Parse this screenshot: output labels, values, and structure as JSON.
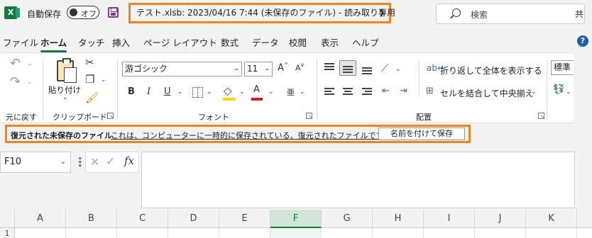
{
  "titlebar": {
    "app_logo": "X",
    "autosave_label": "自動保存",
    "autosave_state": "オフ",
    "document_title": "テスト.xlsb: 2023/04/16 7:44 (未保存のファイル)  -  読み取り専用",
    "search_placeholder": "検索",
    "share_partial": "共"
  },
  "tabs": [
    "ファイル",
    "ホーム",
    "タッチ",
    "挿入",
    "ページ レイアウト",
    "数式",
    "データ",
    "校閲",
    "表示",
    "ヘルプ"
  ],
  "active_tab": "ホーム",
  "ribbon": {
    "undo_group_label": "元に戻す",
    "clipboard": {
      "paste_label": "貼り付け",
      "group_label": "クリップボード"
    },
    "font": {
      "font_name": "游ゴシック",
      "font_size": "11",
      "bold": "B",
      "italic": "I",
      "underline": "U",
      "font_color_letter": "A",
      "grow": "A",
      "shrink": "A",
      "phonetic": "亜",
      "group_label": "フォント",
      "fill_color": "#ffd700",
      "text_color": "#e81123"
    },
    "alignment": {
      "wrap_text": "折り返して全体を表示する",
      "merge_center": "セルを結合して中央揃え",
      "group_label": "配置"
    },
    "number": {
      "format": "標準"
    }
  },
  "infobar": {
    "title": "復元された未保存のファイル",
    "message": "これは、コンピューターに一時的に保存されている、復元されたファイルです。",
    "button": "名前を付けて保存"
  },
  "formula_bar": {
    "name_box": "F10",
    "fx": "fx",
    "cancel": "✕",
    "enter": "✓",
    "value": ""
  },
  "sheet": {
    "columns": [
      "A",
      "B",
      "C",
      "D",
      "E",
      "F",
      "G",
      "H",
      "I",
      "J",
      "K"
    ],
    "selected_column": "F",
    "visible_row": "1"
  },
  "colors": {
    "excel_green": "#107c41",
    "highlight_orange": "#f5821f",
    "help_blue": "#1a5fb4"
  }
}
